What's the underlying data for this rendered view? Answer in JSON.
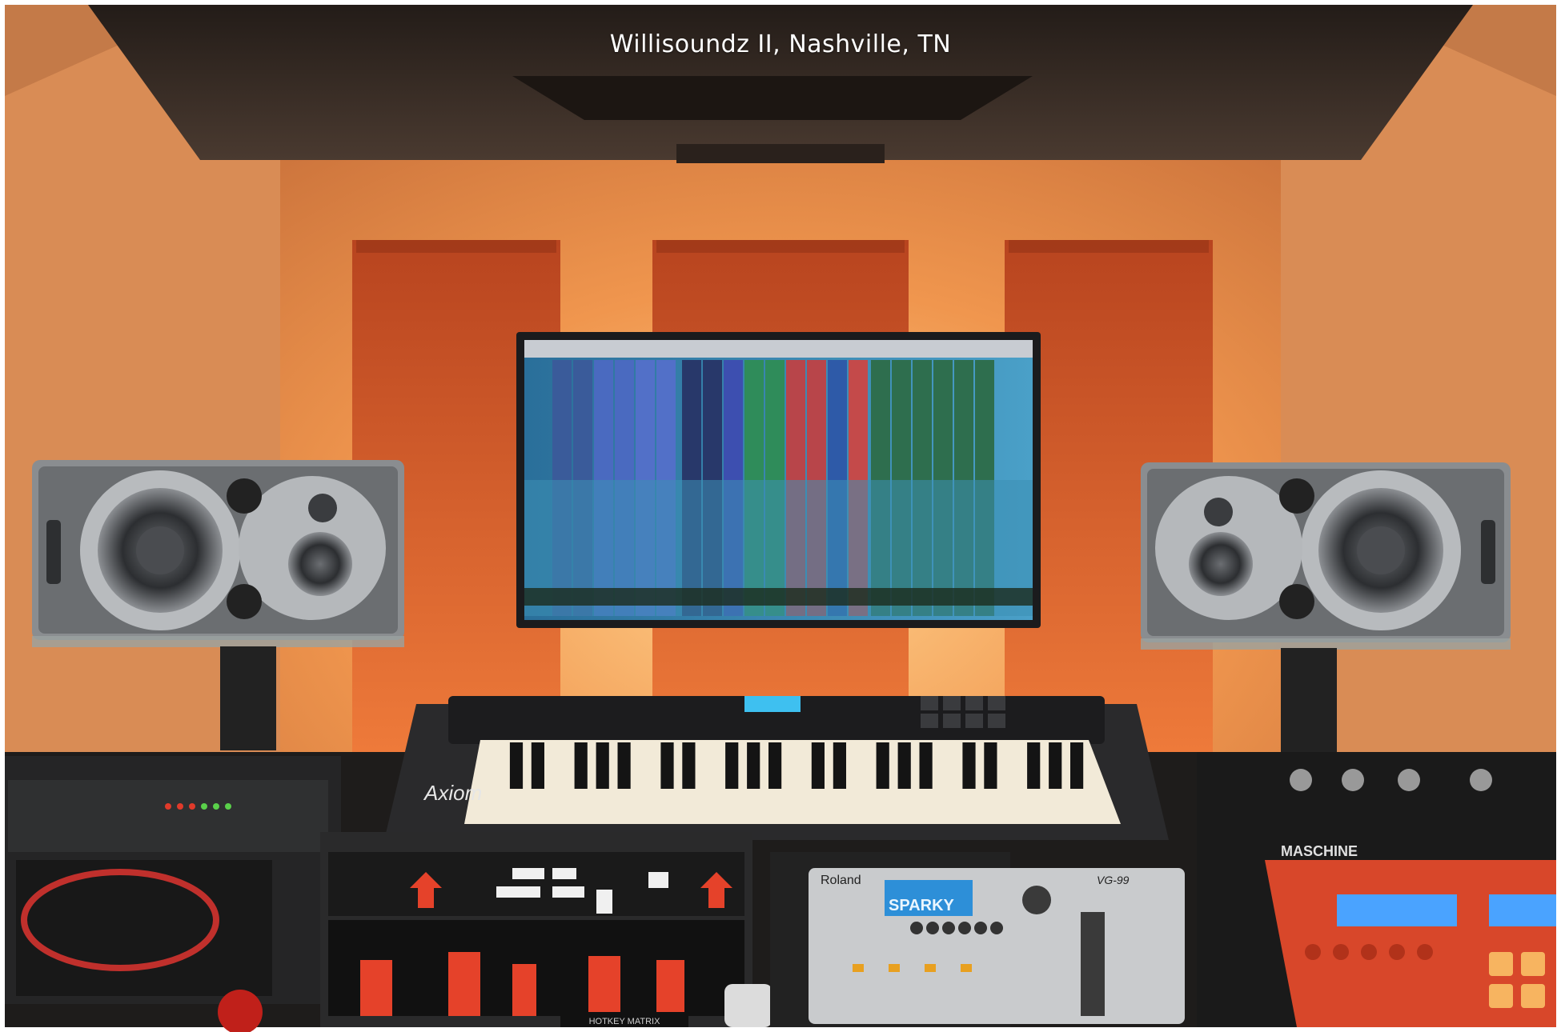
{
  "caption": "Willisoundz II, Nashville, TN",
  "labels": {
    "keyboard_brand": "Axiom",
    "synth_brand": "Roland",
    "synth_model": "VG-99",
    "synth_display": "SPARKY",
    "controller_brand": "MASCHINE",
    "rack_label": "HOTKEY MATRIX"
  },
  "colors": {
    "wall": "#e48b4c",
    "accent_panel": "#d9532a",
    "ceiling": "#2e2622",
    "speaker_body": "#8a8d90",
    "maschine_red": "#d8472a"
  }
}
